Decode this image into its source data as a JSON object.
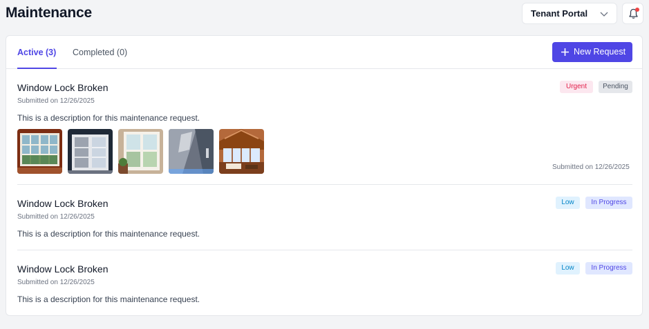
{
  "header": {
    "title": "Maintenance",
    "portal_select": {
      "value": "Tenant Portal"
    },
    "notifications": {
      "icon": "bell-icon",
      "has_unread": true
    }
  },
  "tabs": [
    {
      "label": "Active (3)",
      "active": true
    },
    {
      "label": "Completed (0)",
      "active": false
    }
  ],
  "actions": {
    "new_request_label": "New Request"
  },
  "requests": [
    {
      "title": "Window Lock Broken",
      "submitted": "Submitted on 12/26/2025",
      "description": "This is a description for this maintenance request.",
      "priority": "Urgent",
      "status": "Pending",
      "photos": [
        "window-photo-1",
        "window-photo-2",
        "window-photo-3",
        "interior-photo-4",
        "interior-photo-5"
      ],
      "footer_submitted": "Submitted on 12/26/2025"
    },
    {
      "title": "Window Lock Broken",
      "submitted": "Submitted on 12/26/2025",
      "description": "This is a description for this maintenance request.",
      "priority": "Low",
      "status": "In Progress"
    },
    {
      "title": "Window Lock Broken",
      "submitted": "Submitted on 12/26/2025",
      "description": "This is a description for this maintenance request.",
      "priority": "Low",
      "status": "In Progress"
    }
  ],
  "colors": {
    "accent": "#4f46e5",
    "urgent_bg": "#fce7ef",
    "urgent_text": "#e11d48",
    "low_bg": "#e0f2fe",
    "low_text": "#0284c7",
    "progress_bg": "#e0e7ff",
    "notification_dot": "#ef4444"
  }
}
